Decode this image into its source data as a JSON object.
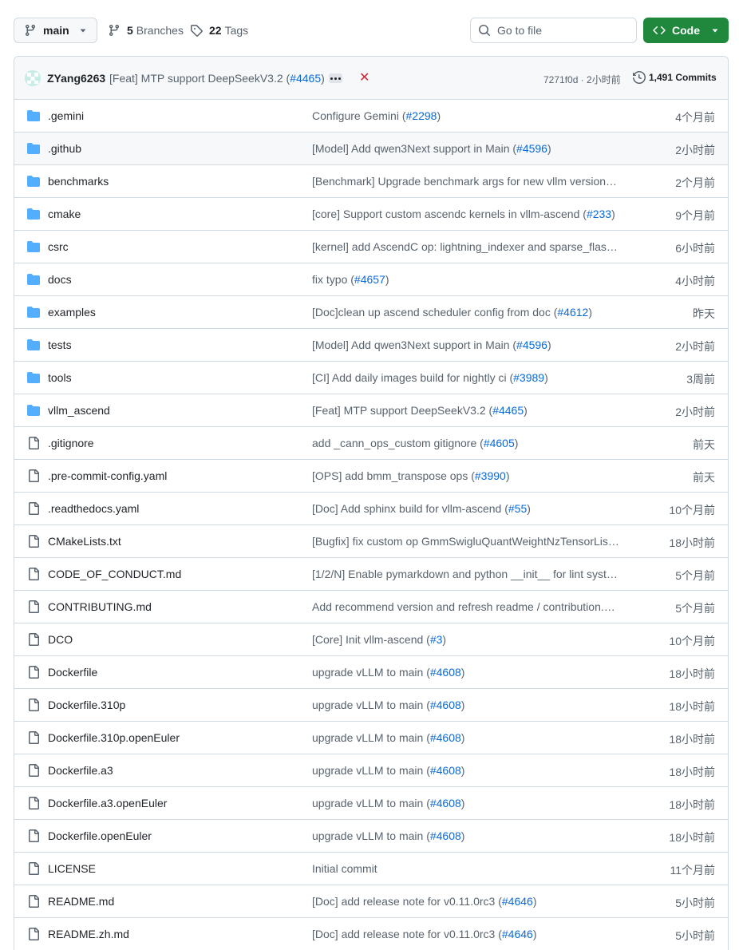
{
  "toolbar": {
    "branch": "main",
    "branches_count": "5",
    "branches_label": "Branches",
    "tags_count": "22",
    "tags_label": "Tags",
    "search_placeholder": "Go to file",
    "code_label": "Code"
  },
  "commit": {
    "author": "ZYang6263",
    "message_text": "[Feat] MTP support DeepSeekV3.2 (",
    "message_link": "#4465",
    "message_tail": ")",
    "sha_time": "7271f0d · 2小时前",
    "commits_label": "1,491 Commits"
  },
  "files": [
    {
      "type": "dir",
      "name": ".gemini",
      "msg": "Configure Gemini (",
      "link": "#2298",
      "tail": ")",
      "age": "4个月前"
    },
    {
      "type": "dir",
      "name": ".github",
      "msg": "[Model] Add qwen3Next support in Main (",
      "link": "#4596",
      "tail": ")",
      "age": "2小时前"
    },
    {
      "type": "dir",
      "name": "benchmarks",
      "msg": "[Benchmark] Upgrade benchmark args for new vllm version (…",
      "link": "",
      "tail": "",
      "age": "2个月前"
    },
    {
      "type": "dir",
      "name": "cmake",
      "msg": "[core] Support custom ascendc kernels in vllm-ascend (",
      "link": "#233",
      "tail": ")",
      "age": "9个月前"
    },
    {
      "type": "dir",
      "name": "csrc",
      "msg": "[kernel] add AscendC op: lightning_indexer and sparse_flash…",
      "link": "",
      "tail": "",
      "age": "6小时前"
    },
    {
      "type": "dir",
      "name": "docs",
      "msg": "fix typo (",
      "link": "#4657",
      "tail": ")",
      "age": "4小时前"
    },
    {
      "type": "dir",
      "name": "examples",
      "msg": "[Doc]clean up ascend scheduler config from doc (",
      "link": "#4612",
      "tail": ")",
      "age": "昨天"
    },
    {
      "type": "dir",
      "name": "tests",
      "msg": "[Model] Add qwen3Next support in Main (",
      "link": "#4596",
      "tail": ")",
      "age": "2小时前"
    },
    {
      "type": "dir",
      "name": "tools",
      "msg": "[CI] Add daily images build for nightly ci (",
      "link": "#3989",
      "tail": ")",
      "age": "3周前"
    },
    {
      "type": "dir",
      "name": "vllm_ascend",
      "msg": "[Feat] MTP support DeepSeekV3.2 (",
      "link": "#4465",
      "tail": ")",
      "age": "2小时前"
    },
    {
      "type": "file",
      "name": ".gitignore",
      "msg": "add _cann_ops_custom gitignore (",
      "link": "#4605",
      "tail": ")",
      "age": "前天"
    },
    {
      "type": "file",
      "name": ".pre-commit-config.yaml",
      "msg": "[OPS] add bmm_transpose ops (",
      "link": "#3990",
      "tail": ")",
      "age": "前天"
    },
    {
      "type": "file",
      "name": ".readthedocs.yaml",
      "msg": "[Doc] Add sphinx build for vllm-ascend (",
      "link": "#55",
      "tail": ")",
      "age": "10个月前"
    },
    {
      "type": "file",
      "name": "CMakeLists.txt",
      "msg": "[Bugfix] fix custom op GmmSwigluQuantWeightNzTensorList…",
      "link": "",
      "tail": "",
      "age": "18小时前"
    },
    {
      "type": "file",
      "name": "CODE_OF_CONDUCT.md",
      "msg": "[1/2/N] Enable pymarkdown and python __init__ for lint syst…",
      "link": "",
      "tail": "",
      "age": "5个月前"
    },
    {
      "type": "file",
      "name": "CONTRIBUTING.md",
      "msg": "Add recommend version and refresh readme / contribution.…",
      "link": "",
      "tail": "",
      "age": "5个月前"
    },
    {
      "type": "file",
      "name": "DCO",
      "msg": "[Core] Init vllm-ascend (",
      "link": "#3",
      "tail": ")",
      "age": "10个月前"
    },
    {
      "type": "file",
      "name": "Dockerfile",
      "msg": "upgrade vLLM to main (",
      "link": "#4608",
      "tail": ")",
      "age": "18小时前"
    },
    {
      "type": "file",
      "name": "Dockerfile.310p",
      "msg": "upgrade vLLM to main (",
      "link": "#4608",
      "tail": ")",
      "age": "18小时前"
    },
    {
      "type": "file",
      "name": "Dockerfile.310p.openEuler",
      "msg": "upgrade vLLM to main (",
      "link": "#4608",
      "tail": ")",
      "age": "18小时前"
    },
    {
      "type": "file",
      "name": "Dockerfile.a3",
      "msg": "upgrade vLLM to main (",
      "link": "#4608",
      "tail": ")",
      "age": "18小时前"
    },
    {
      "type": "file",
      "name": "Dockerfile.a3.openEuler",
      "msg": "upgrade vLLM to main (",
      "link": "#4608",
      "tail": ")",
      "age": "18小时前"
    },
    {
      "type": "file",
      "name": "Dockerfile.openEuler",
      "msg": "upgrade vLLM to main (",
      "link": "#4608",
      "tail": ")",
      "age": "18小时前"
    },
    {
      "type": "file",
      "name": "LICENSE",
      "msg": "Initial commit",
      "link": "",
      "tail": "",
      "age": "11个月前"
    },
    {
      "type": "file",
      "name": "README.md",
      "msg": "[Doc] add release note for v0.11.0rc3 (",
      "link": "#4646",
      "tail": ")",
      "age": "5小时前"
    },
    {
      "type": "file",
      "name": "README.zh.md",
      "msg": "[Doc] add release note for v0.11.0rc3 (",
      "link": "#4646",
      "tail": ")",
      "age": "5小时前"
    }
  ],
  "highlighted_row": 1,
  "colors": {
    "accent_link": "#0969da",
    "folder": "#54aeff",
    "primary_button": "#1f883d",
    "danger": "#d1242f"
  },
  "icons": {
    "branch": "git-branch-icon",
    "tag": "tag-icon",
    "search": "search-icon",
    "code": "code-icon",
    "history": "history-icon",
    "folder": "folder-icon",
    "file": "file-icon",
    "fail": "x-icon"
  }
}
